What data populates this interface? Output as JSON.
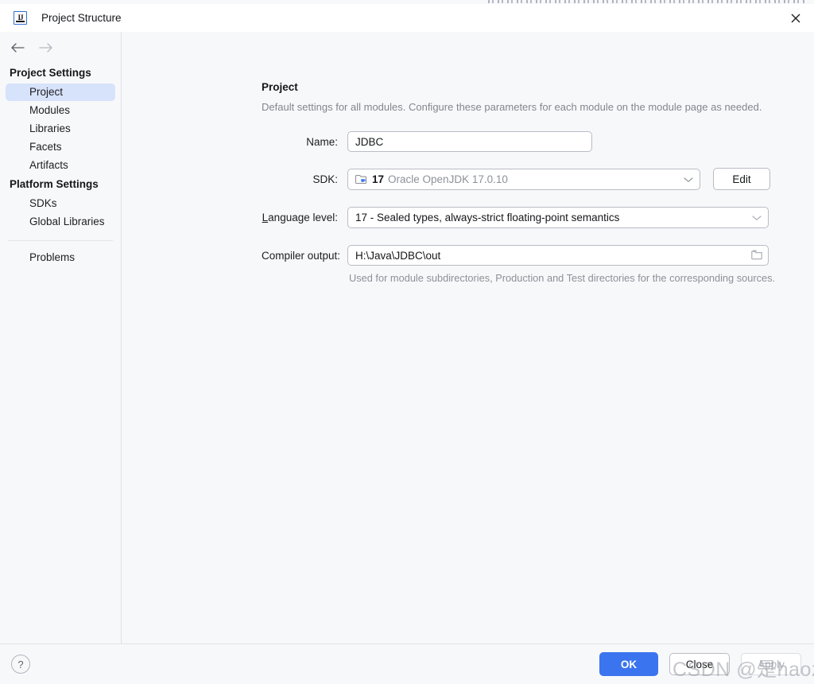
{
  "window": {
    "title": "Project Structure",
    "app_icon": "intellij-idea-icon",
    "close_label": "✕"
  },
  "nav": {
    "back": "back-arrow",
    "forward": "forward-arrow"
  },
  "sidebar": {
    "groups": [
      {
        "title": "Project Settings",
        "items": [
          {
            "label": "Project",
            "selected": true
          },
          {
            "label": "Modules",
            "selected": false
          },
          {
            "label": "Libraries",
            "selected": false
          },
          {
            "label": "Facets",
            "selected": false
          },
          {
            "label": "Artifacts",
            "selected": false
          }
        ]
      },
      {
        "title": "Platform Settings",
        "items": [
          {
            "label": "SDKs",
            "selected": false
          },
          {
            "label": "Global Libraries",
            "selected": false
          }
        ]
      }
    ],
    "extra_items": [
      {
        "label": "Problems",
        "selected": false
      }
    ]
  },
  "main": {
    "title": "Project",
    "description": "Default settings for all modules. Configure these parameters for each module on the module page as needed.",
    "fields": {
      "name": {
        "label": "Name:",
        "value": "JDBC"
      },
      "sdk": {
        "label": "SDK:",
        "version": "17",
        "name": "Oracle OpenJDK 17.0.10",
        "icon": "jdk-folder-icon",
        "edit_button": "Edit"
      },
      "language_level": {
        "label_mnemonic": "L",
        "label_rest": "anguage level:",
        "value": "17 - Sealed types, always-strict floating-point semantics"
      },
      "compiler_output": {
        "label": "Compiler output:",
        "value": "H:\\Java\\JDBC\\out",
        "browse_icon": "folder-icon",
        "hint": "Used for module subdirectories, Production and Test directories for the corresponding sources."
      }
    }
  },
  "footer": {
    "help": "?",
    "ok": "OK",
    "close": "Close",
    "apply": "Apply"
  },
  "watermark": {
    "text": "CSDN @是haozhua"
  },
  "colors": {
    "accent": "#3a74ee",
    "selection": "#d7e2fb",
    "panel": "#f7f8fa",
    "border": "#b9bcc4",
    "muted_text": "#8d9097"
  }
}
